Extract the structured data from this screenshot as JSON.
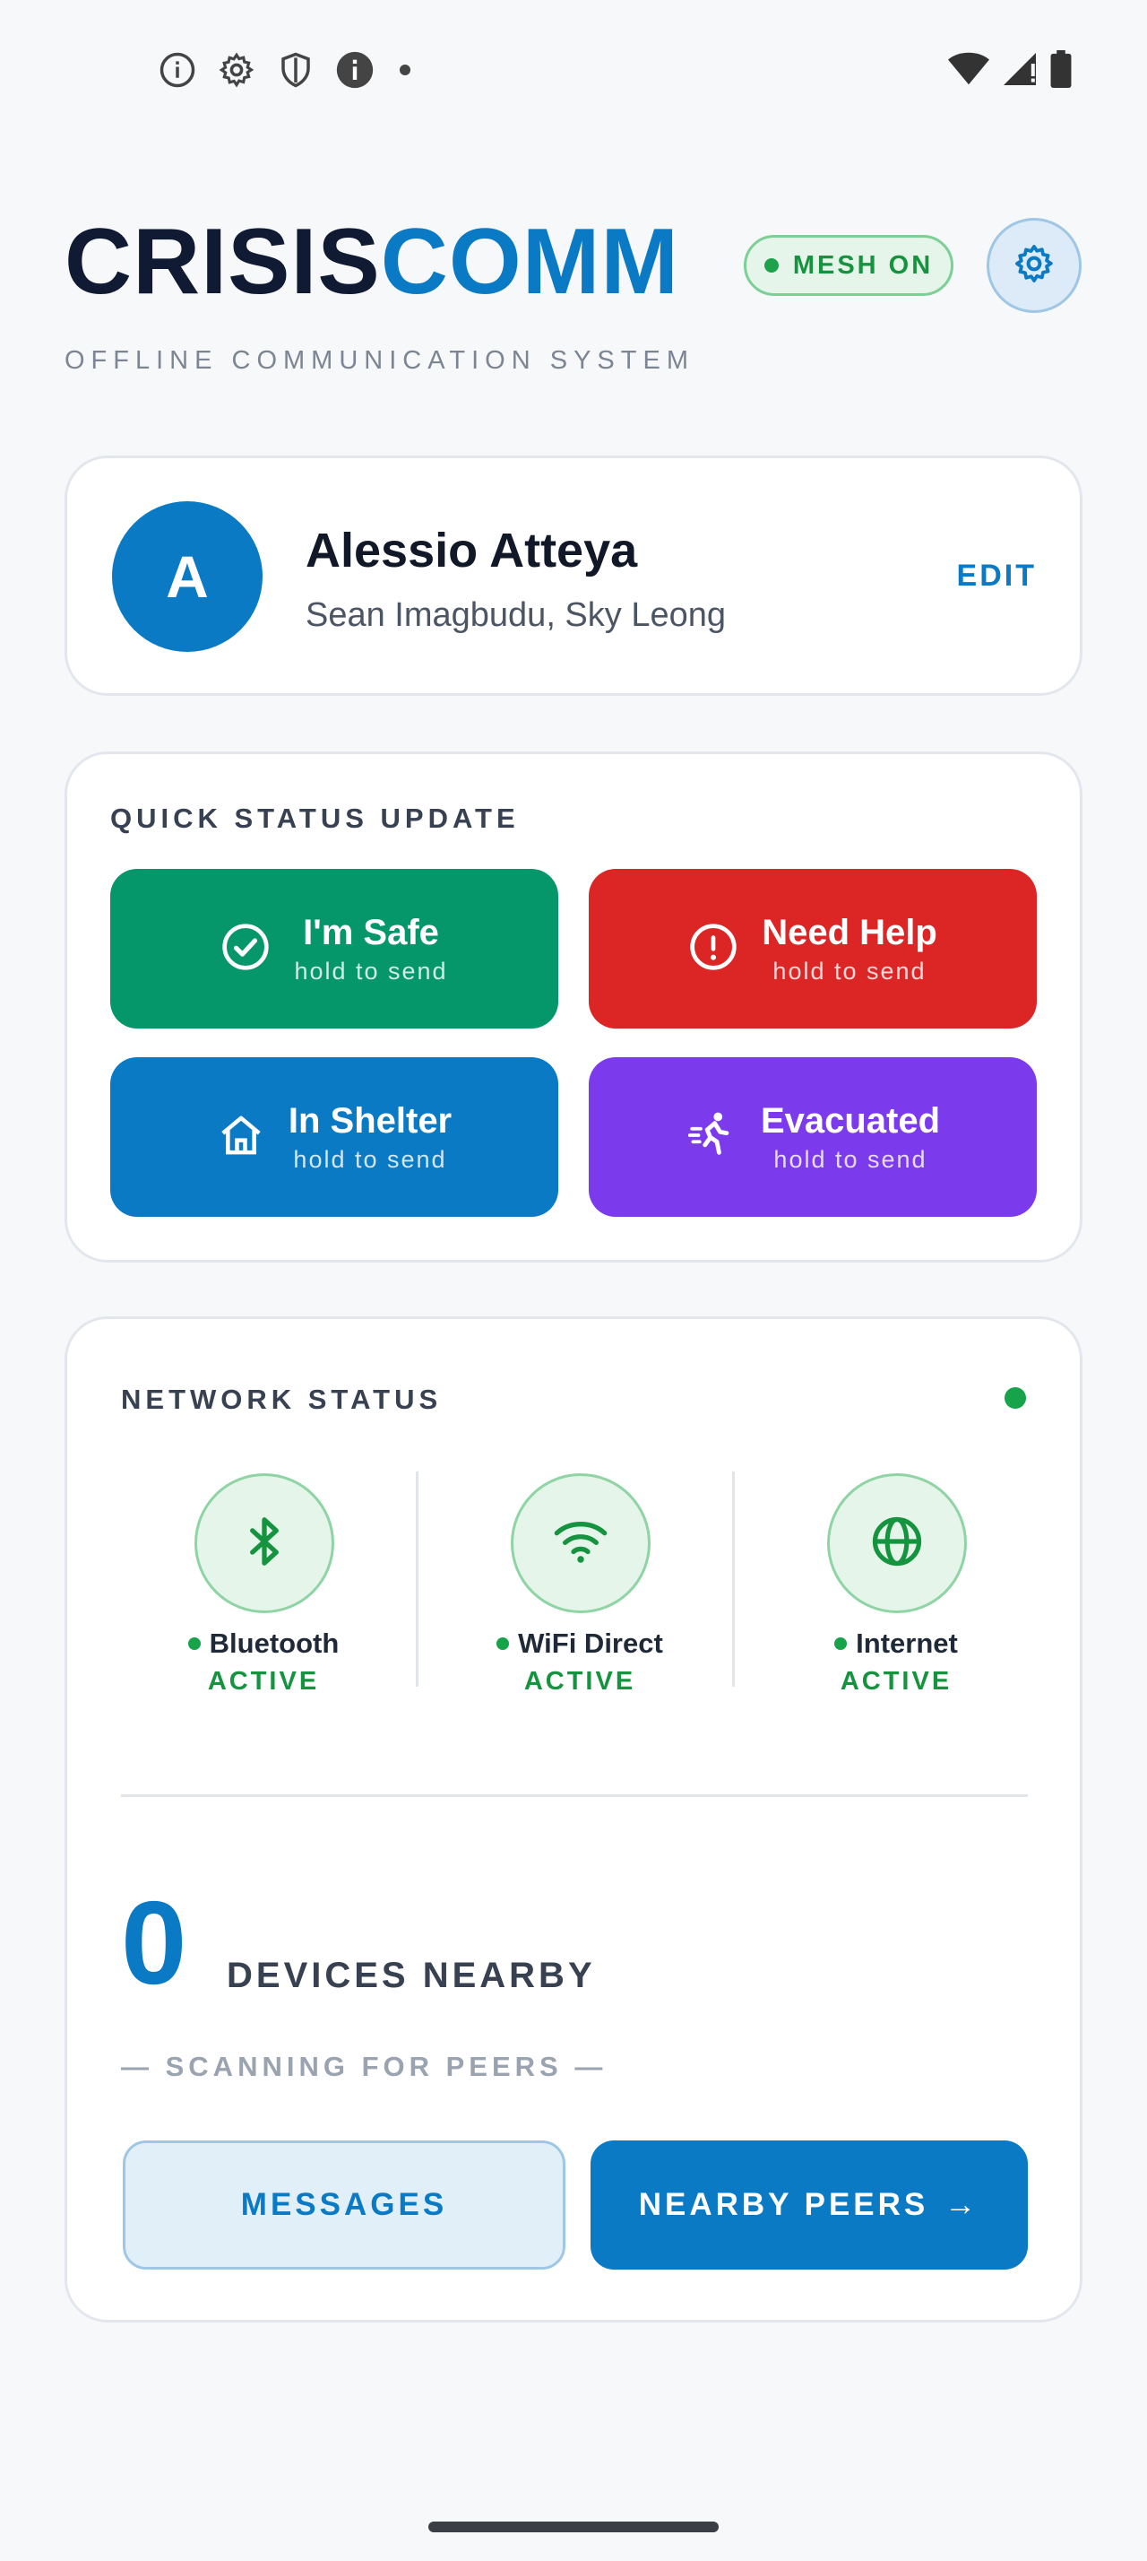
{
  "status_bar": {
    "left_icons": [
      "info-outline-icon",
      "settings-icon",
      "shield-icon",
      "info-filled-icon",
      "notification-dot-icon"
    ],
    "right_icons": [
      "wifi-icon",
      "signal-icon",
      "battery-icon"
    ]
  },
  "header": {
    "brand_part1": "CRISIS",
    "brand_part2": "COMM",
    "tagline": "OFFLINE COMMUNICATION SYSTEM",
    "mesh_label": "MESH ON"
  },
  "profile": {
    "avatar_initial": "A",
    "name": "Alessio Atteya",
    "contacts": "Sean Imagbudu, Sky Leong",
    "edit_label": "EDIT"
  },
  "quick_status": {
    "title": "QUICK STATUS UPDATE",
    "buttons": [
      {
        "label": "I'm Safe",
        "hint": "hold to send",
        "icon": "check-circle-icon",
        "color": "#059669"
      },
      {
        "label": "Need Help",
        "hint": "hold to send",
        "icon": "alert-circle-icon",
        "color": "#dc2626"
      },
      {
        "label": "In Shelter",
        "hint": "hold to send",
        "icon": "home-icon",
        "color": "#0a7ac4"
      },
      {
        "label": "Evacuated",
        "hint": "hold to send",
        "icon": "running-person-icon",
        "color": "#7c3aed"
      }
    ]
  },
  "network": {
    "title": "NETWORK STATUS",
    "items": [
      {
        "name": "Bluetooth",
        "state": "ACTIVE",
        "icon": "bluetooth-icon"
      },
      {
        "name": "WiFi Direct",
        "state": "ACTIVE",
        "icon": "wifi-icon"
      },
      {
        "name": "Internet",
        "state": "ACTIVE",
        "icon": "globe-icon"
      }
    ],
    "devices_count": "0",
    "devices_label": "DEVICES NEARBY",
    "scanning_text": "— SCANNING FOR PEERS —",
    "messages_button": "MESSAGES",
    "peers_button": "NEARBY PEERS",
    "peers_arrow": "→"
  },
  "colors": {
    "accent": "#0a7ac4",
    "success": "#16a34a",
    "danger": "#dc2626",
    "purple": "#7c3aed"
  }
}
